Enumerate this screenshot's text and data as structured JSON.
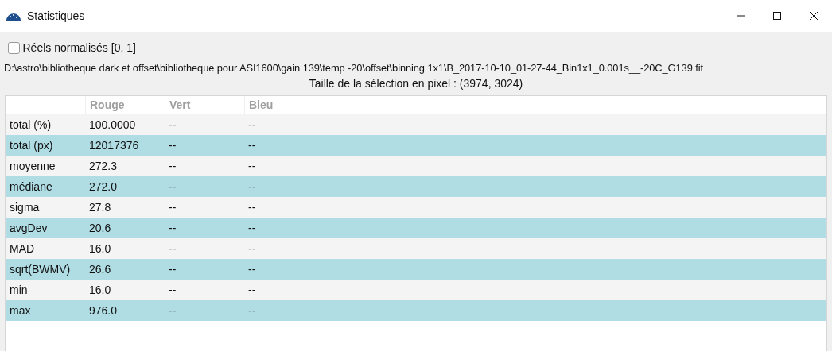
{
  "window": {
    "title": "Statistiques"
  },
  "normalize_checkbox": {
    "label": "Réels normalisés [0, 1]",
    "checked": false
  },
  "file_path": "D:\\astro\\bibliotheque dark et offset\\bibliotheque pour ASI1600\\gain 139\\temp -20\\offset\\binning 1x1\\B_2017-10-10_01-27-44_Bin1x1_0.001s__-20C_G139.fit",
  "selection_size": "Taille de la sélection en pixel : (3974, 3024)",
  "table": {
    "columns": [
      "Rouge",
      "Vert",
      "Bleu"
    ],
    "rows": [
      {
        "label": "total (%)",
        "cells": [
          "100.0000",
          "--",
          "--"
        ]
      },
      {
        "label": "total (px)",
        "cells": [
          "12017376",
          "--",
          "--"
        ]
      },
      {
        "label": "moyenne",
        "cells": [
          "272.3",
          "--",
          "--"
        ]
      },
      {
        "label": "médiane",
        "cells": [
          "272.0",
          "--",
          "--"
        ]
      },
      {
        "label": "sigma",
        "cells": [
          "27.8",
          "--",
          "--"
        ]
      },
      {
        "label": "avgDev",
        "cells": [
          "20.6",
          "--",
          "--"
        ]
      },
      {
        "label": "MAD",
        "cells": [
          "16.0",
          "--",
          "--"
        ]
      },
      {
        "label": "sqrt(BWMV)",
        "cells": [
          "26.6",
          "--",
          "--"
        ]
      },
      {
        "label": "min",
        "cells": [
          "16.0",
          "--",
          "--"
        ]
      },
      {
        "label": "max",
        "cells": [
          "976.0",
          "--",
          "--"
        ]
      }
    ]
  }
}
